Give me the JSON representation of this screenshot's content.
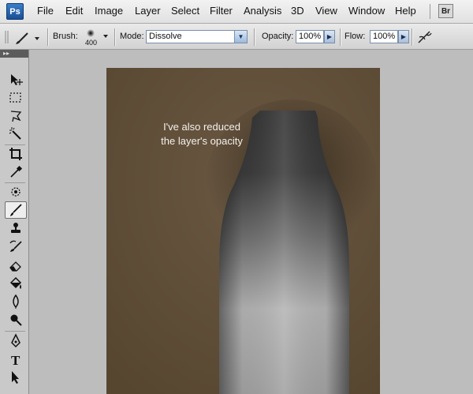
{
  "app": {
    "logo": "Ps"
  },
  "menu": {
    "items": [
      "File",
      "Edit",
      "Image",
      "Layer",
      "Select",
      "Filter",
      "Analysis",
      "3D",
      "View",
      "Window",
      "Help"
    ],
    "bridge_label": "Br"
  },
  "options": {
    "brush_label": "Brush:",
    "brush_size": "400",
    "mode_label": "Mode:",
    "mode_value": "Dissolve",
    "opacity_label": "Opacity:",
    "opacity_value": "100%",
    "flow_label": "Flow:",
    "flow_value": "100%"
  },
  "toolbox": {
    "tools": [
      "move-tool-icon",
      "marquee-tool-icon",
      "lasso-tool-icon",
      "magic-wand-tool-icon",
      "crop-tool-icon",
      "eyedropper-tool-icon",
      "spot-healing-tool-icon",
      "brush-tool-icon",
      "clone-stamp-tool-icon",
      "history-brush-tool-icon",
      "eraser-tool-icon",
      "paint-bucket-tool-icon",
      "blur-tool-icon",
      "dodge-tool-icon",
      "pen-tool-icon",
      "type-tool-icon",
      "path-selection-tool-icon"
    ],
    "active_tool": "brush-tool-icon"
  },
  "canvas": {
    "caption_line1": "I've also reduced",
    "caption_line2": "the layer's opacity",
    "background_color": "#5f4d3a"
  }
}
